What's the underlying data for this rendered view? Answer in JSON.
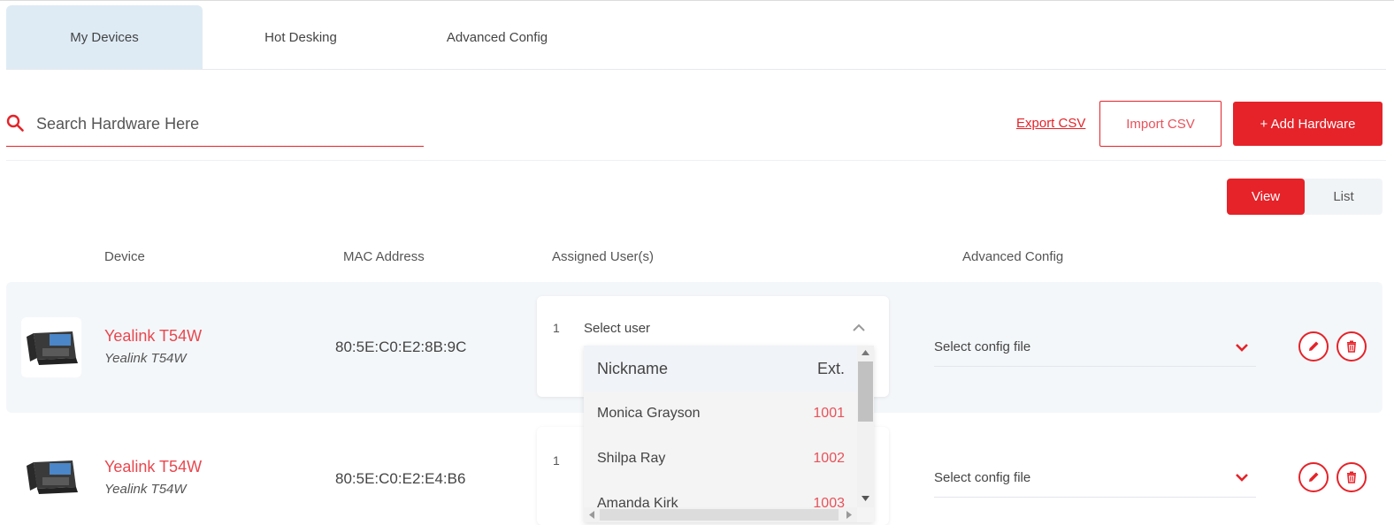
{
  "tabs": [
    {
      "label": "My Devices",
      "active": true
    },
    {
      "label": "Hot Desking",
      "active": false
    },
    {
      "label": "Advanced Config",
      "active": false
    }
  ],
  "search": {
    "placeholder": "Search Hardware Here"
  },
  "actions": {
    "export_label": "Export CSV",
    "import_label": "Import CSV",
    "add_label": "+ Add Hardware"
  },
  "view_toggle": {
    "view_label": "View",
    "list_label": "List",
    "selected": "View"
  },
  "columns": {
    "device": "Device",
    "mac": "MAC Address",
    "assigned": "Assigned User(s)",
    "config": "Advanced Config"
  },
  "devices": [
    {
      "name": "Yealink T54W",
      "model": "Yealink T54W",
      "mac": "80:5E:C0:E2:8B:9C",
      "assign_index": "1",
      "assign_placeholder": "Select user",
      "config_placeholder": "Select config file"
    },
    {
      "name": "Yealink T54W",
      "model": "Yealink T54W",
      "mac": "80:5E:C0:E2:E4:B6",
      "assign_index": "1",
      "assign_placeholder": "Select user",
      "config_placeholder": "Select config file"
    }
  ],
  "user_dropdown": {
    "header_nickname": "Nickname",
    "header_ext": "Ext.",
    "users": [
      {
        "name": "Monica Grayson",
        "ext": "1001"
      },
      {
        "name": "Shilpa Ray",
        "ext": "1002"
      },
      {
        "name": "Amanda Kirk",
        "ext": "1003"
      }
    ]
  },
  "colors": {
    "accent": "#e52329",
    "active_tab": "#deebf5",
    "row_bg": "#f4f7fa"
  },
  "icons": [
    "search-icon",
    "chevron-up-icon",
    "chevron-down-icon",
    "pencil-icon",
    "trash-icon",
    "desk-phone-icon"
  ]
}
